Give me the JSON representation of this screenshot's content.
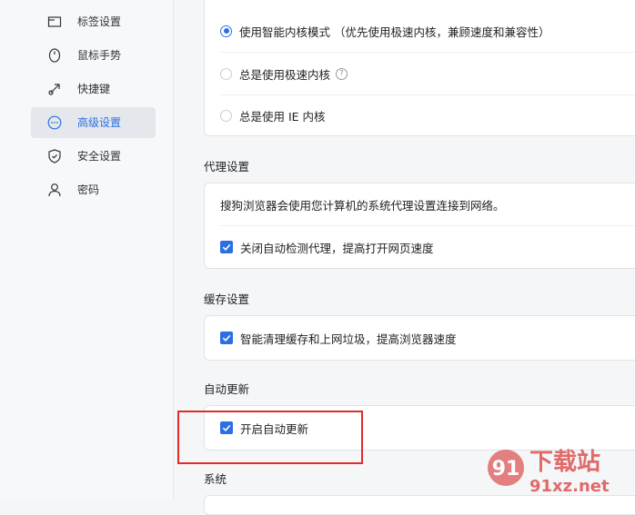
{
  "sidebar": {
    "items": [
      {
        "label": "标签设置",
        "icon": "tab-icon"
      },
      {
        "label": "鼠标手势",
        "icon": "mouse-icon"
      },
      {
        "label": "快捷键",
        "icon": "shortcut-arrow-icon"
      },
      {
        "label": "高级设置",
        "icon": "more-circle-icon",
        "active": true
      },
      {
        "label": "安全设置",
        "icon": "shield-icon"
      },
      {
        "label": "密码",
        "icon": "user-icon"
      }
    ]
  },
  "kernel": {
    "options": [
      {
        "label": "使用智能内核模式 （优先使用极速内核，兼顾速度和兼容性）",
        "selected": true
      },
      {
        "label": "总是使用极速内核",
        "selected": false,
        "help": "?"
      },
      {
        "label": "总是使用 IE 内核",
        "selected": false
      }
    ]
  },
  "proxy": {
    "title": "代理设置",
    "description": "搜狗浏览器会使用您计算机的系统代理设置连接到网络。",
    "option": {
      "label": "关闭自动检测代理，提高打开网页速度",
      "checked": true
    }
  },
  "cache": {
    "title": "缓存设置",
    "option": {
      "label": "智能清理缓存和上网垃圾，提高浏览器速度",
      "checked": true
    }
  },
  "update": {
    "title": "自动更新",
    "option": {
      "label": "开启自动更新",
      "checked": true
    }
  },
  "system": {
    "title": "系统"
  },
  "watermark": {
    "brand": "下载站",
    "logo_text": "91",
    "site": "91xz.net"
  },
  "colors": {
    "accent": "#2b6fe2",
    "highlight": "#e22a2a",
    "watermark": "#e06a6a"
  }
}
